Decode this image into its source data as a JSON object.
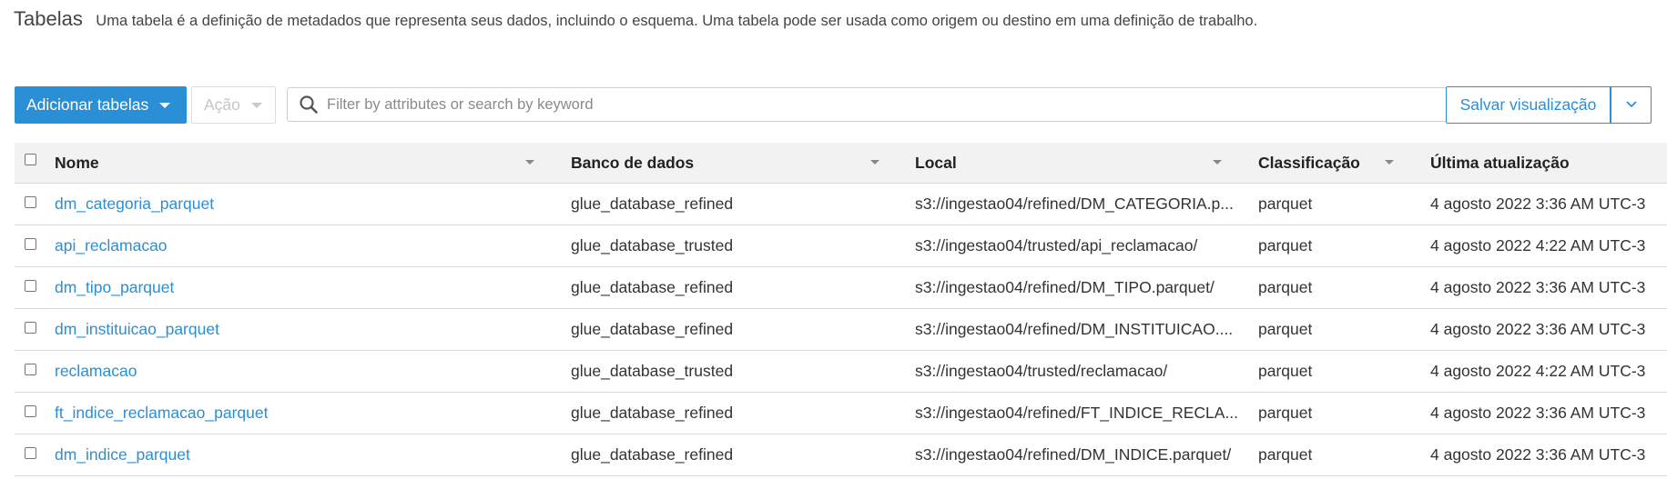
{
  "header": {
    "title": "Tabelas",
    "description": "Uma tabela é a definição de metadados que representa seus dados, incluindo o esquema. Uma tabela pode ser usada como origem ou destino em uma definição de trabalho."
  },
  "toolbar": {
    "add_tables_label": "Adicionar tabelas",
    "action_label": "Ação",
    "search_placeholder": "Filter by attributes or search by keyword",
    "search_value": "",
    "save_view_label": "Salvar visualização"
  },
  "table": {
    "columns": [
      "Nome",
      "Banco de dados",
      "Local",
      "Classificação",
      "Última atualização"
    ],
    "rows": [
      {
        "name": "dm_categoria_parquet",
        "database": "glue_database_refined",
        "location": "s3://ingestao04/refined/DM_CATEGORIA.p...",
        "classification": "parquet",
        "updated": "4 agosto 2022 3:36 AM UTC-3"
      },
      {
        "name": "api_reclamacao",
        "database": "glue_database_trusted",
        "location": "s3://ingestao04/trusted/api_reclamacao/",
        "classification": "parquet",
        "updated": "4 agosto 2022 4:22 AM UTC-3"
      },
      {
        "name": "dm_tipo_parquet",
        "database": "glue_database_refined",
        "location": "s3://ingestao04/refined/DM_TIPO.parquet/",
        "classification": "parquet",
        "updated": "4 agosto 2022 3:36 AM UTC-3"
      },
      {
        "name": "dm_instituicao_parquet",
        "database": "glue_database_refined",
        "location": "s3://ingestao04/refined/DM_INSTITUICAO....",
        "classification": "parquet",
        "updated": "4 agosto 2022 3:36 AM UTC-3"
      },
      {
        "name": "reclamacao",
        "database": "glue_database_trusted",
        "location": "s3://ingestao04/trusted/reclamacao/",
        "classification": "parquet",
        "updated": "4 agosto 2022 4:22 AM UTC-3"
      },
      {
        "name": "ft_indice_reclamacao_parquet",
        "database": "glue_database_refined",
        "location": "s3://ingestao04/refined/FT_INDICE_RECLA...",
        "classification": "parquet",
        "updated": "4 agosto 2022 3:36 AM UTC-3"
      },
      {
        "name": "dm_indice_parquet",
        "database": "glue_database_refined",
        "location": "s3://ingestao04/refined/DM_INDICE.parquet/",
        "classification": "parquet",
        "updated": "4 agosto 2022 3:36 AM UTC-3"
      }
    ]
  },
  "icons": {
    "search": "search-icon",
    "add_caret": "caret-down-icon",
    "save_dropdown": "chevron-down-icon",
    "sort": "sort-caret-icon"
  },
  "colors": {
    "accent": "#2a8fd4",
    "header_bg": "#f2f2f2",
    "border": "#d9d9d9"
  }
}
